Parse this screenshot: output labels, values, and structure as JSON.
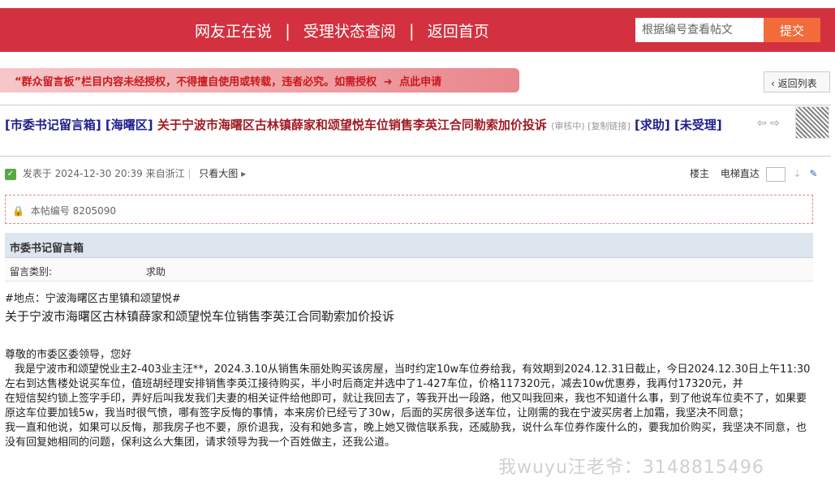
{
  "header": {
    "nav": [
      "网友正在说",
      "受理状态查阅",
      "返回首页"
    ],
    "search_placeholder": "根据编号查看帖文",
    "search_button": "提交",
    "brand_color": "#d3313f"
  },
  "notice": {
    "text": "“群众留言板”栏目内容未经授权，不得擅自使用或转载，违者必究。如需授权",
    "link": "点此申请"
  },
  "back_button": "返回列表",
  "post": {
    "title_tags": "[市委书记留言箱] [海曙区]",
    "title": "关于宁波市海曙区古林镇薛家和颂望悦车位销售李英江合同勒索加价投诉",
    "status_small": "(审核中) [复制链接]",
    "tag_help": "[求助]",
    "tag_status": "[未受理]",
    "meta": "发表于 2024-12-30 20:39 来自浙江",
    "only_image": "只看大图",
    "floor_owner": "楼主",
    "elevator": "电梯直达",
    "post_id": "本帖编号 8205090",
    "section_title": "市委书记留言箱",
    "category_key": "留言类别:",
    "category_value": "求助",
    "location": "#地点：宁波海曙区古里镇和颂望悦#",
    "body_title": "关于宁波市海曙区古林镇薛家和颂望悦车位销售李英江合同勒索加价投诉",
    "greeting": "尊敬的市委区委领导，您好",
    "para1": "我是宁波市和颂望悦业主2-403业主汪**，2024.3.10从销售朱丽处购买该房屋，当时约定10w车位券给我，有效期到2024.12.31日截止，今日2024.12.30日上午11:30左右到达售楼处说买车位，值班胡经理安排销售李英江接待购买，半小时后商定并选中了1-427车位，价格117320元，减去10w优惠券，我再付17320元，并",
    "para2": "在短信契约锁上签字手印，弄好后叫我发我们夫妻的相关证件给他即可，就让我回去了，等我开出一段路，他又叫我回来，我也不知道什么事，到了他说车位卖不了，如果要原这车位要加钱5w，我当时很气愤，哪有签字反悔的事情，本来房价已经亏了30w，后面的买房很多送车位，让刚需的我在宁波买房者上加霜，我坚决不同意；",
    "para3": "我一直和他说，如果可以反悔，那我房子也不要，原价退我，没有和她多言，晚上她又微信联系我，还威胁我，说什么车位券作废什么的，要我加价购买，我坚决不同意，也没有回复她相同的问题，保利这么大集团，请求领导为我一个百姓做主，还我公道。",
    "watermark": "我wuyu汪老爷：3148815496"
  }
}
